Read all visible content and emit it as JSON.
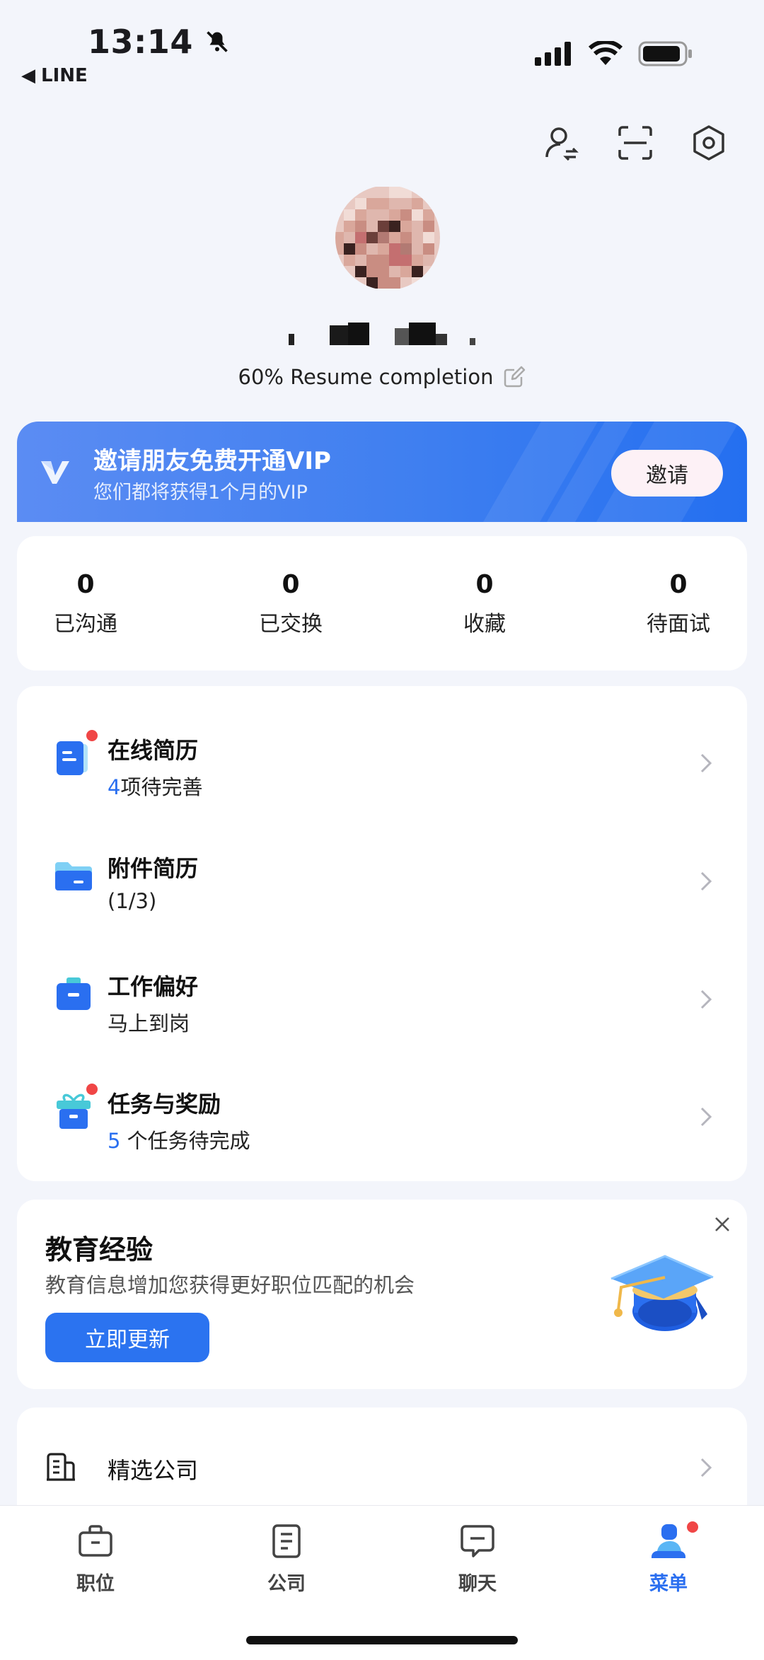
{
  "status_bar": {
    "time": "13:14",
    "back_label": "LINE",
    "icons": [
      "bell-mute-icon",
      "signal-icon",
      "wifi-icon",
      "battery-icon"
    ]
  },
  "top_actions": [
    "switch-identity-icon",
    "scan-icon",
    "settings-icon"
  ],
  "profile": {
    "resume_completion": "60% Resume completion"
  },
  "vip_banner": {
    "title": "邀请朋友免费开通VIP",
    "subtitle": "您们都将获得1个月的VIP",
    "button": "邀请"
  },
  "stats": [
    {
      "value": "0",
      "label": "已沟通"
    },
    {
      "value": "0",
      "label": "已交换"
    },
    {
      "value": "0",
      "label": "收藏"
    },
    {
      "value": "0",
      "label": "待面试"
    }
  ],
  "menu": [
    {
      "title": "在线简历",
      "sub_highlight": "4",
      "sub_text": "项待完善",
      "badge": true
    },
    {
      "title": "附件简历",
      "sub_highlight": "",
      "sub_text": "(1/3)",
      "badge": false
    },
    {
      "title": "工作偏好",
      "sub_highlight": "",
      "sub_text": "马上到岗",
      "badge": false
    },
    {
      "title": "任务与奖励",
      "sub_highlight": "5",
      "sub_text": " 个任务待完成",
      "badge": true
    }
  ],
  "education": {
    "title": "教育经验",
    "subtitle": "教育信息增加您获得更好职位匹配的机会",
    "button": "立即更新"
  },
  "featured": {
    "label": "精选公司"
  },
  "nav": [
    {
      "label": "职位",
      "icon": "briefcase-icon",
      "active": false
    },
    {
      "label": "公司",
      "icon": "company-icon",
      "active": false
    },
    {
      "label": "聊天",
      "icon": "chat-icon",
      "active": false
    },
    {
      "label": "菜单",
      "icon": "menu-person-icon",
      "active": true
    }
  ],
  "colors": {
    "accent": "#2b6ff0",
    "badge": "#f04646",
    "background": "#f3f5fb"
  }
}
